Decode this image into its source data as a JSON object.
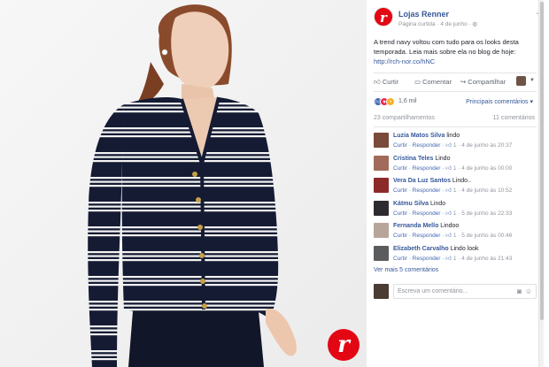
{
  "post": {
    "page_name": "Lojas Renner",
    "meta": "Página curtida · 4 de junho · ",
    "text_1": "A trend navy voltou com tudo para os looks desta temporada. Leia mais sobre ela no blog de hoje:",
    "link": "http://rch-nor.co/hNC",
    "brand_letter": "r"
  },
  "actions": {
    "like": "Curtir",
    "comment": "Comentar",
    "share": "Compartilhar"
  },
  "reactions": {
    "count": "1,6 mil",
    "sort": "Principais comentários"
  },
  "stats": {
    "shares": "23 compartilhamentos",
    "comments": "11 comentários"
  },
  "comments": [
    {
      "name": "Luzia Matos Silva",
      "text": "lindo",
      "meta_prefix": "Curtir · Responder · ",
      "likes": "1",
      "time": " · 4 de junho às 20:37",
      "avatar": "#7a4a3a"
    },
    {
      "name": "Cristina Teles",
      "text": "Lindo",
      "meta_prefix": "Curtir · Responder · ",
      "likes": "1",
      "time": " · 4 de junho às 00:00",
      "avatar": "#a26a5a"
    },
    {
      "name": "Vera Da Luz Santos",
      "text": "Lindo..",
      "meta_prefix": "Curtir · Responder · ",
      "likes": "1",
      "time": " · 4 de junho às 10:52",
      "avatar": "#8c2a2a"
    },
    {
      "name": "Kátmu Silva",
      "text": "Lindo",
      "meta_prefix": "Curtir · Responder · ",
      "likes": "1",
      "time": " · 5 de junho às 22:33",
      "avatar": "#2d2a30"
    },
    {
      "name": "Fernanda Mello",
      "text": "Lindoo",
      "meta_prefix": "Curtir · Responder · ",
      "likes": "1",
      "time": " · 5 de junho às 00:46",
      "avatar": "#b8a59a"
    },
    {
      "name": "Elizabeth Carvalho",
      "text": "Lindo look",
      "meta_prefix": "Curtir · Responder · ",
      "likes": "1",
      "time": " · 4 de junho às 21:43",
      "avatar": "#5a5c5e"
    }
  ],
  "more_comments": "Ver mais 5 comentários",
  "composer": {
    "placeholder": "Escreva um comentário..."
  },
  "icons": {
    "like": "thumbs-up-icon",
    "comment": "speech-bubble-icon",
    "share": "share-arrow-icon",
    "camera": "camera-icon",
    "emoji": "smiley-icon"
  }
}
